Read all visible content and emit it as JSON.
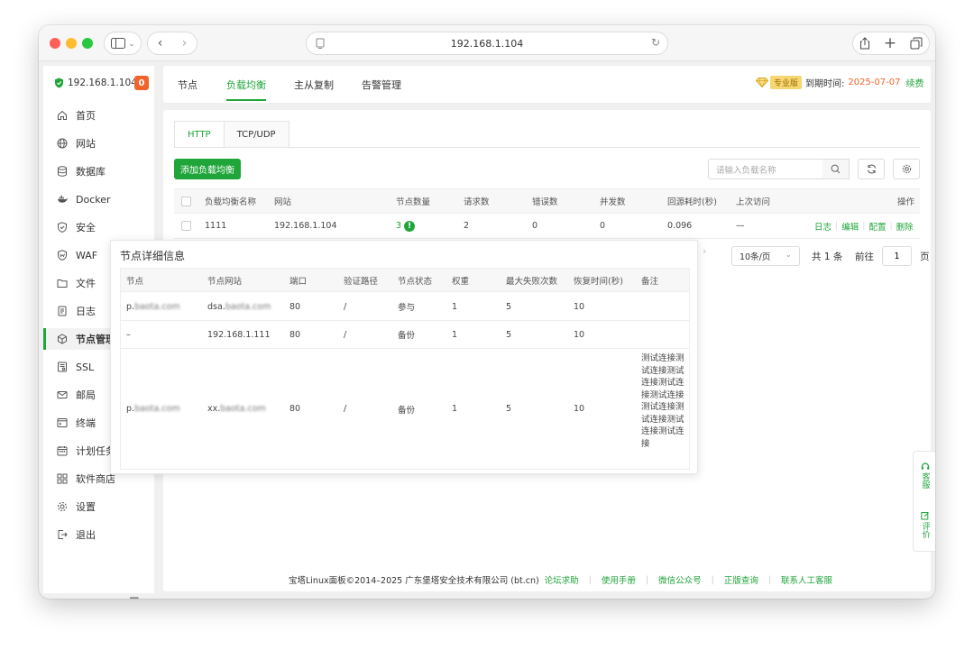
{
  "browser": {
    "url": "192.168.1.104"
  },
  "sidebar": {
    "server": "192.168.1.104",
    "badge": "0",
    "items": [
      {
        "label": "首页",
        "icon": "home-icon"
      },
      {
        "label": "网站",
        "icon": "globe-icon"
      },
      {
        "label": "数据库",
        "icon": "database-icon"
      },
      {
        "label": "Docker",
        "icon": "docker-icon"
      },
      {
        "label": "安全",
        "icon": "shield-icon"
      },
      {
        "label": "WAF",
        "icon": "waf-shield-icon"
      },
      {
        "label": "文件",
        "icon": "folder-icon"
      },
      {
        "label": "日志",
        "icon": "log-icon"
      },
      {
        "label": "节点管理",
        "icon": "cube-icon"
      },
      {
        "label": "SSL",
        "icon": "certificate-icon"
      },
      {
        "label": "邮局",
        "icon": "mail-icon"
      },
      {
        "label": "终端",
        "icon": "terminal-icon"
      },
      {
        "label": "计划任务",
        "icon": "calendar-icon"
      },
      {
        "label": "软件商店",
        "icon": "grid-icon"
      },
      {
        "label": "设置",
        "icon": "gear-icon"
      },
      {
        "label": "退出",
        "icon": "logout-icon"
      }
    ]
  },
  "topnav": {
    "tabs": [
      "节点",
      "负载均衡",
      "主从复制",
      "告警管理"
    ],
    "pro_tag": "专业版",
    "expire_label": "到期时间:",
    "expire_date": "2025-07-07",
    "renew": "续费"
  },
  "lb": {
    "tabs": [
      "HTTP",
      "TCP/UDP"
    ],
    "add_button": "添加负载均衡",
    "search_placeholder": "请输入负载名称",
    "columns": [
      "负载均衡名称",
      "网站",
      "节点数量",
      "请求数",
      "错误数",
      "并发数",
      "回源耗时(秒)",
      "上次访问",
      "操作"
    ],
    "row": {
      "name": "1111",
      "site": "192.168.1.104",
      "nodes": "3",
      "nodes_alert": "!",
      "requests": "2",
      "errors": "0",
      "concurrent": "0",
      "latency": "0.096",
      "last": "—",
      "actions": [
        "日志",
        "编辑",
        "配置",
        "删除"
      ]
    },
    "pagination": {
      "page_size": "10条/页",
      "total": "共 1 条",
      "goto": "前往",
      "page": "1",
      "page_suffix": "页"
    }
  },
  "popover": {
    "title": "节点详细信息",
    "columns": [
      "节点",
      "节点网站",
      "端口",
      "验证路径",
      "节点状态",
      "权重",
      "最大失败次数",
      "恢复时间(秒)",
      "备注"
    ],
    "rows": [
      {
        "node": "p.",
        "node_blur": "baota.com",
        "site": "dsa.",
        "site_blur": "baota.com",
        "port": "80",
        "path": "/",
        "status": "参与",
        "weight": "1",
        "max_fail": "5",
        "recover": "10",
        "remark": ""
      },
      {
        "node": "–",
        "node_blur": "",
        "site": "192.168.1.111",
        "site_blur": "",
        "port": "80",
        "path": "/",
        "status": "备份",
        "weight": "1",
        "max_fail": "5",
        "recover": "10",
        "remark": ""
      },
      {
        "node": "p.",
        "node_blur": "baota.com",
        "site": "xx.",
        "site_blur": "baota.com",
        "port": "80",
        "path": "/",
        "status": "备份",
        "weight": "1",
        "max_fail": "5",
        "recover": "10",
        "remark": "测试连接测试连接测试连接测试连接测试连接测试连接测试连接测试连接测试连接"
      }
    ]
  },
  "footer": {
    "copyright": "宝塔Linux面板©2014–2025 广东堡塔安全技术有限公司 (bt.cn)",
    "links": [
      "论坛求助",
      "使用手册",
      "微信公众号",
      "正版查询",
      "联系人工客服"
    ]
  },
  "float": {
    "service": "客服",
    "review": "评价"
  },
  "colors": {
    "accent": "#20a53a",
    "warning": "#f0642c"
  }
}
